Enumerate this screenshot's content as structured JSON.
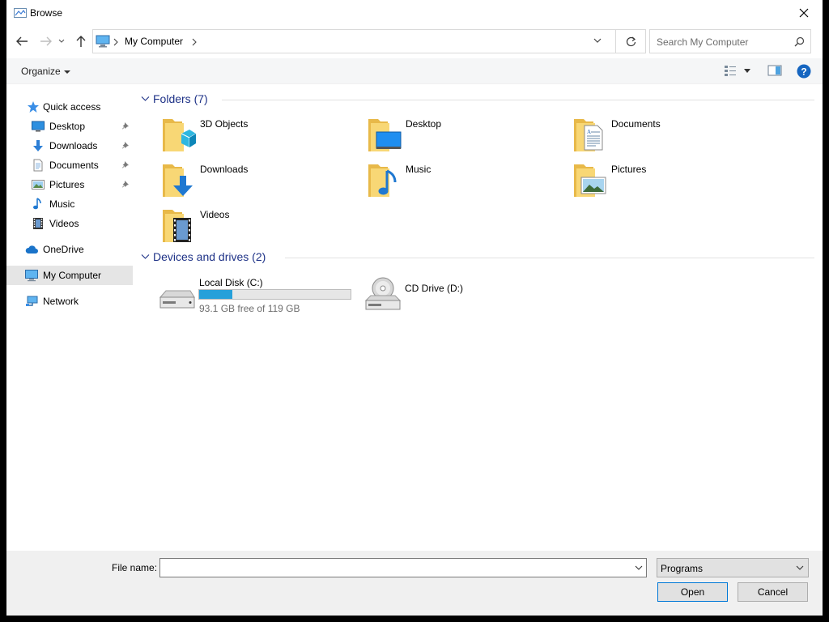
{
  "window": {
    "title": "Browse"
  },
  "nav": {
    "breadcrumb": "My Computer",
    "search_placeholder": "Search My Computer"
  },
  "toolbar": {
    "organize_label": "Organize"
  },
  "sidebar": {
    "items": [
      {
        "label": "Quick access",
        "icon": "star-icon"
      },
      {
        "label": "Desktop",
        "icon": "desktop-icon",
        "pinned": true
      },
      {
        "label": "Downloads",
        "icon": "download-icon",
        "pinned": true
      },
      {
        "label": "Documents",
        "icon": "document-icon",
        "pinned": true
      },
      {
        "label": "Pictures",
        "icon": "pictures-icon",
        "pinned": true
      },
      {
        "label": "Music",
        "icon": "music-icon"
      },
      {
        "label": "Videos",
        "icon": "videos-icon"
      },
      {
        "label": "OneDrive",
        "icon": "cloud-icon"
      },
      {
        "label": "My Computer",
        "icon": "computer-icon",
        "selected": true
      },
      {
        "label": "Network",
        "icon": "network-icon"
      }
    ]
  },
  "folders": {
    "header": "Folders (7)",
    "items": [
      {
        "label": "3D Objects",
        "icon": "3d-objects-folder-icon"
      },
      {
        "label": "Desktop",
        "icon": "desktop-folder-icon"
      },
      {
        "label": "Documents",
        "icon": "documents-folder-icon"
      },
      {
        "label": "Downloads",
        "icon": "downloads-folder-icon"
      },
      {
        "label": "Music",
        "icon": "music-folder-icon"
      },
      {
        "label": "Pictures",
        "icon": "pictures-folder-icon"
      },
      {
        "label": "Videos",
        "icon": "videos-folder-icon"
      }
    ]
  },
  "drives": {
    "header": "Devices and drives (2)",
    "items": [
      {
        "label": "Local Disk (C:)",
        "free_text": "93.1 GB free of 119 GB",
        "used_fraction": 0.22,
        "icon": "hard-drive-icon"
      },
      {
        "label": "CD Drive (D:)",
        "icon": "cd-drive-icon"
      }
    ]
  },
  "bottom": {
    "filename_label": "File name:",
    "filename_value": "",
    "filter_value": "Programs",
    "open_label": "Open",
    "cancel_label": "Cancel"
  },
  "colors": {
    "accent": "#0078d7",
    "group_header": "#1e3287",
    "progress": "#26a0da",
    "folder": "#f8d775"
  }
}
